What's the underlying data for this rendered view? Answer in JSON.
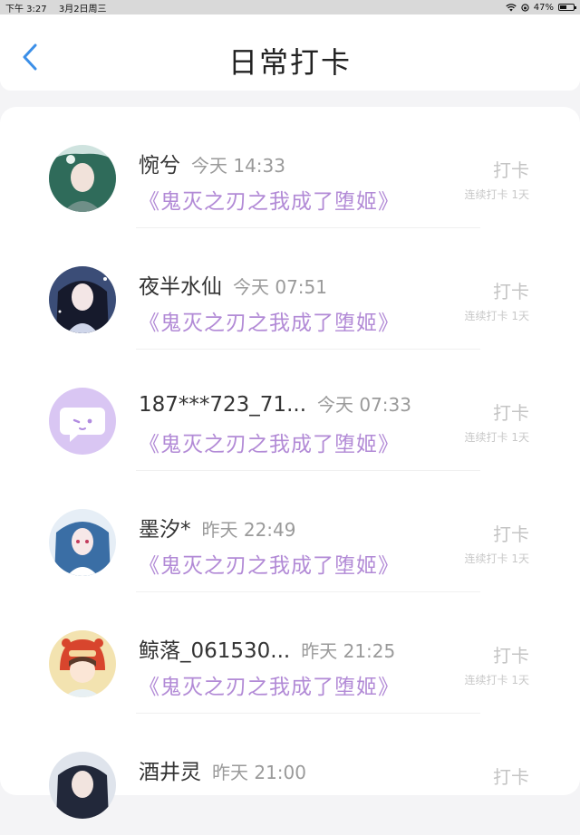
{
  "status_bar": {
    "time": "下午 3:27",
    "date": "3月2日周三",
    "battery": "47%",
    "battery_level": 0.47
  },
  "header": {
    "title": "日常打卡",
    "back_icon": "chevron-left-icon",
    "accent_color": "#3b8fe8"
  },
  "records": [
    {
      "name": "惋兮",
      "time": "今天 14:33",
      "book": "《鬼灭之刃之我成了堕姬》",
      "action": "打卡",
      "streak": "连续打卡 1天",
      "avatar": "avatar-green-hair"
    },
    {
      "name": "夜半水仙",
      "time": "今天 07:51",
      "book": "《鬼灭之刃之我成了堕姬》",
      "action": "打卡",
      "streak": "连续打卡 1天",
      "avatar": "avatar-dark-hair"
    },
    {
      "name": "187***723_71...",
      "time": "今天 07:33",
      "book": "《鬼灭之刃之我成了堕姬》",
      "action": "打卡",
      "streak": "连续打卡 1天",
      "avatar": "avatar-default-chat"
    },
    {
      "name": "墨汐*",
      "time": "昨天 22:49",
      "book": "《鬼灭之刃之我成了堕姬》",
      "action": "打卡",
      "streak": "连续打卡 1天",
      "avatar": "avatar-blue-hair"
    },
    {
      "name": "鲸落_061530...",
      "time": "昨天 21:25",
      "book": "《鬼灭之刃之我成了堕姬》",
      "action": "打卡",
      "streak": "连续打卡 1天",
      "avatar": "avatar-red-hood"
    },
    {
      "name": "酒井灵",
      "time": "昨天 21:00",
      "book": "",
      "action": "打卡",
      "streak": "",
      "avatar": "avatar-dark-hair-2"
    }
  ]
}
